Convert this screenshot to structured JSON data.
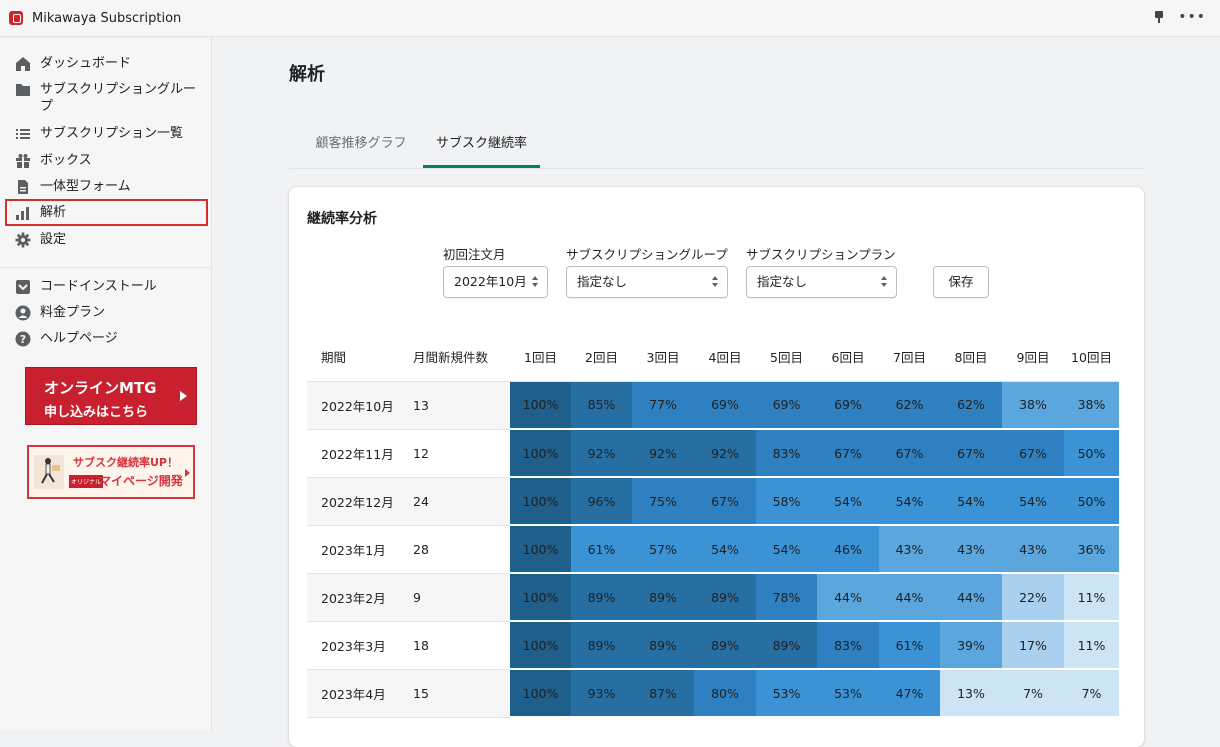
{
  "app": {
    "title": "Mikawaya Subscription"
  },
  "sidebar": {
    "items": [
      {
        "label": "ダッシュボード",
        "icon": "home-icon"
      },
      {
        "label": "サブスクリプショングループ",
        "icon": "folder-icon"
      },
      {
        "label": "サブスクリプション一覧",
        "icon": "list-icon"
      },
      {
        "label": "ボックス",
        "icon": "gift-icon"
      },
      {
        "label": "一体型フォーム",
        "icon": "document-icon"
      },
      {
        "label": "解析",
        "icon": "analytics-icon"
      },
      {
        "label": "設定",
        "icon": "gear-icon"
      },
      {
        "label": "コードインストール",
        "icon": "install-icon"
      },
      {
        "label": "料金プラン",
        "icon": "user-icon"
      },
      {
        "label": "ヘルプページ",
        "icon": "help-icon"
      }
    ],
    "banner_mtg": {
      "line1": "オンラインMTG",
      "line2": "申し込みはこちら"
    },
    "banner_up": {
      "line1": "サブスク継続率UP！",
      "tag": "オリジナル",
      "line2": "マイページ開発"
    }
  },
  "page": {
    "title": "解析"
  },
  "tabs": [
    {
      "label": "顧客推移グラフ",
      "active": false
    },
    {
      "label": "サブスク継続率",
      "active": true
    }
  ],
  "card": {
    "title": "継続率分析",
    "filters": {
      "first_order_month": {
        "label": "初回注文月",
        "value": "2022年10月"
      },
      "group": {
        "label": "サブスクリプショングループ",
        "value": "指定なし"
      },
      "plan": {
        "label": "サブスクリプションプラン",
        "value": "指定なし"
      }
    },
    "save_label": "保存"
  },
  "table": {
    "headers": [
      "期間",
      "月間新規件数",
      "1回目",
      "2回目",
      "3回目",
      "4回目",
      "5回目",
      "6回目",
      "7回目",
      "8回目",
      "9回目",
      "10回目"
    ],
    "rows": [
      {
        "period": "2022年10月",
        "new": "13",
        "values": [
          100,
          85,
          77,
          69,
          69,
          69,
          62,
          62,
          38,
          38
        ]
      },
      {
        "period": "2022年11月",
        "new": "12",
        "values": [
          100,
          92,
          92,
          92,
          83,
          67,
          67,
          67,
          67,
          50
        ]
      },
      {
        "period": "2022年12月",
        "new": "24",
        "values": [
          100,
          96,
          75,
          67,
          58,
          54,
          54,
          54,
          54,
          50
        ]
      },
      {
        "period": "2023年1月",
        "new": "28",
        "values": [
          100,
          61,
          57,
          54,
          54,
          46,
          43,
          43,
          43,
          36
        ]
      },
      {
        "period": "2023年2月",
        "new": "9",
        "values": [
          100,
          89,
          89,
          89,
          78,
          44,
          44,
          44,
          22,
          11
        ]
      },
      {
        "period": "2023年3月",
        "new": "18",
        "values": [
          100,
          89,
          89,
          89,
          89,
          83,
          61,
          39,
          17,
          11
        ]
      },
      {
        "period": "2023年4月",
        "new": "15",
        "values": [
          100,
          93,
          87,
          80,
          53,
          53,
          47,
          13,
          7,
          7
        ]
      }
    ],
    "colors": {
      "c100": "#1f5f8b",
      "c85": "#276fa3",
      "c70": "#2f80c0",
      "c50": "#3b93d6",
      "c40": "#5aa6dd",
      "c20": "#a9d0ee",
      "c10": "#cde4f5"
    }
  }
}
